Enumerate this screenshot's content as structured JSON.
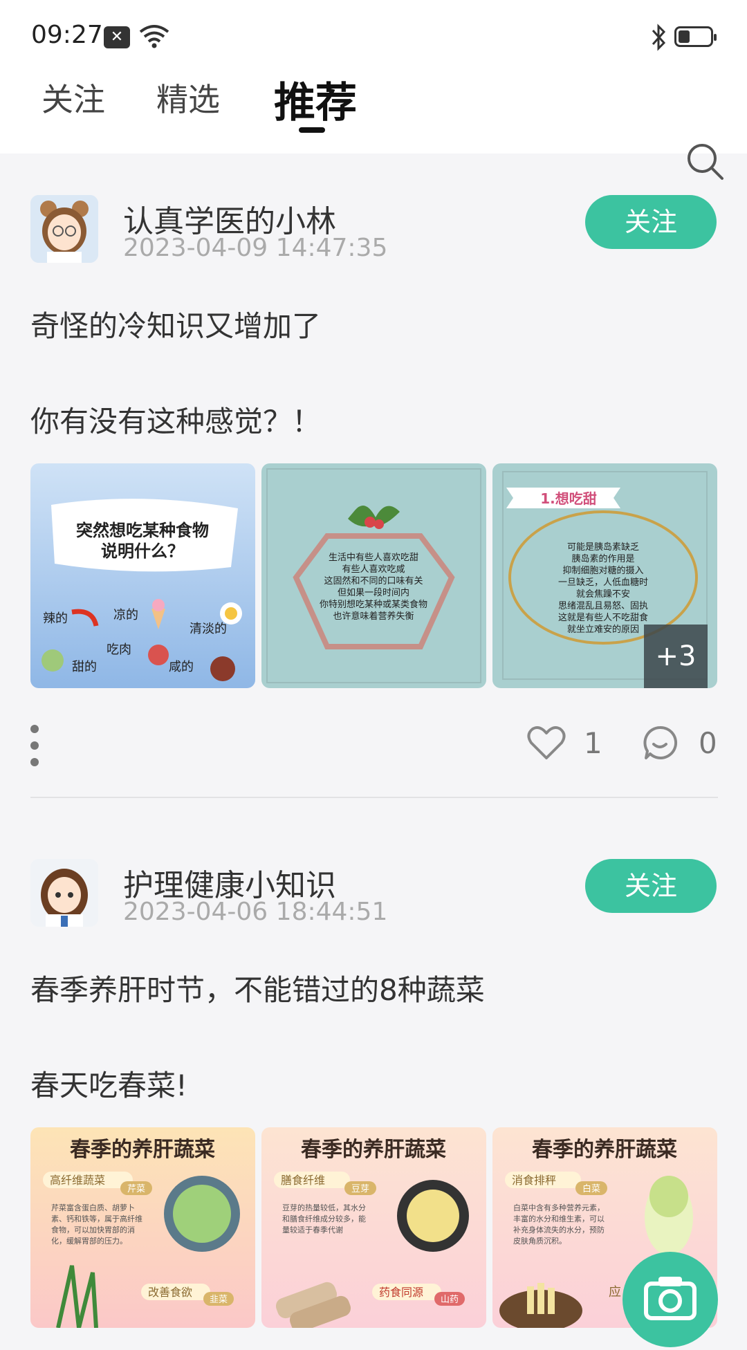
{
  "status_bar": {
    "time": "09:27",
    "icons": [
      "notification-icon",
      "wifi-icon",
      "bluetooth-icon",
      "battery-icon"
    ]
  },
  "tabs": [
    {
      "label": "关注"
    },
    {
      "label": "精选"
    },
    {
      "label": "推荐",
      "active": true
    }
  ],
  "search_icon": "search-icon",
  "posts": [
    {
      "author": "认真学医的小林",
      "date": "2023-04-09 14:47:35",
      "follow_label": "关注",
      "text_lines": [
        "奇怪的冷知识又增加了",
        "你有没有这种感觉？！"
      ],
      "images": [
        {
          "caption": "突然想吃某种食物说明什么？",
          "labels": [
            "辣的",
            "凉的",
            "清淡的",
            "甜的",
            "吃肉",
            "咸的"
          ]
        },
        {
          "caption": "生活中有些人喜欢吃甜 有些人喜欢吃咸 这固然和不同的口味有关 但如果一段时间内 你特别想吃某种或某类食物 也许意味着营养失衡"
        },
        {
          "caption": "1.想吃甜",
          "body": "可能是胰岛素缺乏 胰岛素的作用是 抑制细胞对糖的摄入 一旦缺乏，人低血糖时 就会焦躁不安 思绪混乱且易怒、固执 这就是有些人不吃甜食 就坐立难安的原因"
        }
      ],
      "more_images": "+3",
      "likes": "1",
      "comments": "0"
    },
    {
      "author": "护理健康小知识",
      "date": "2023-04-06 18:44:51",
      "follow_label": "关注",
      "text_lines": [
        "春季养肝时节，不能错过的8种蔬菜",
        "春天吃春菜!"
      ],
      "images": [
        {
          "title": "春季的养肝蔬菜",
          "tag": "高纤维蔬菜",
          "sub": "芹菜",
          "tag2": "改善食欲",
          "sub2": "韭菜"
        },
        {
          "title": "春季的养肝蔬菜",
          "tag": "膳食纤维",
          "sub": "豆芽",
          "tag2": "药食同源",
          "sub2": "山药"
        },
        {
          "title": "春季的养肝蔬菜",
          "tag": "消食排秤",
          "sub": "白菜",
          "tag2": "应",
          "sub2": ""
        }
      ]
    }
  ],
  "fab_icon": "camera-icon",
  "colors": {
    "accent": "#3cc3a0",
    "background": "#f5f5f7"
  }
}
